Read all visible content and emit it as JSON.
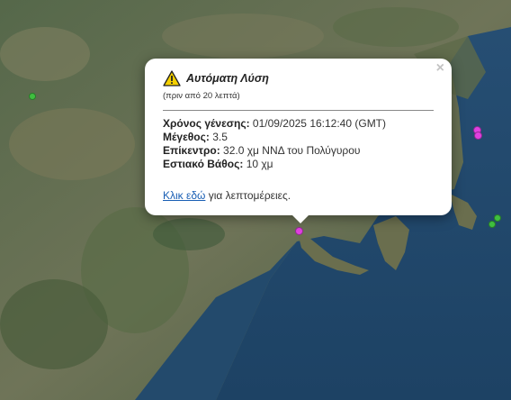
{
  "popup": {
    "title": "Αυτόματη Λύση",
    "subtitle": "(πριν από 20 λεπτά)",
    "close_symbol": "×",
    "fields": [
      {
        "label": "Χρόνος γένεσης:",
        "value": "01/09/2025 16:12:40 (GMT)"
      },
      {
        "label": "Μέγεθος:",
        "value": "3.5"
      },
      {
        "label": "Επίκεντρο:",
        "value": "32.0 χμ ΝΝΔ του Πολύγυρου"
      },
      {
        "label": "Εστιακό Βάθος:",
        "value": "10 χμ"
      }
    ],
    "link_text": "Κλικ εδώ",
    "link_suffix": " για λεπτομέρειες.",
    "icon": "warning-triangle-icon"
  },
  "markers": [
    {
      "name": "selected-earthquake-marker",
      "color": "#e040e0"
    },
    {
      "name": "earthquake-marker-east-1",
      "color": "#e040e0"
    },
    {
      "name": "earthquake-marker-east-2",
      "color": "#e040e0"
    },
    {
      "name": "earthquake-marker-west",
      "color": "#3fbf3f"
    },
    {
      "name": "earthquake-marker-southeast-1",
      "color": "#3fbf3f"
    },
    {
      "name": "earthquake-marker-southeast-2",
      "color": "#3fbf3f"
    }
  ],
  "colors": {
    "sea": "#244a6b",
    "land_dark": "#3f5a3a",
    "land_light": "#8a8a6a",
    "link": "#1a5fb4"
  }
}
